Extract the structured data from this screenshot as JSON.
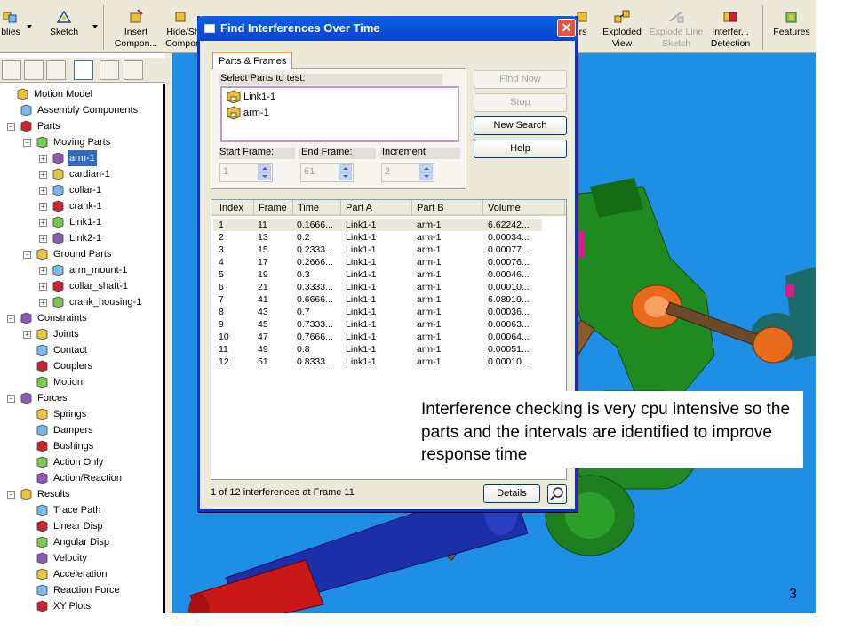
{
  "toolbar": {
    "items": [
      {
        "label": "blies",
        "icon": "assemblies-icon"
      },
      {
        "label": "Sketch",
        "icon": "sketch-icon"
      },
      {
        "label": "Insert Compon...",
        "icon": "insert-component-icon"
      },
      {
        "label": "Hide/Sh Compon",
        "icon": "hide-show-icon"
      },
      {
        "label": "rs",
        "icon": "partial-icon"
      },
      {
        "label": "Exploded View",
        "icon": "exploded-view-icon"
      },
      {
        "label": "Explode Line Sketch",
        "icon": "explode-line-sketch-icon",
        "disabled": true
      },
      {
        "label": "Interfer... Detection",
        "icon": "interference-detection-icon"
      },
      {
        "label": "Features",
        "icon": "features-icon"
      }
    ]
  },
  "tree": {
    "nodes": [
      {
        "label": "Motion Model",
        "level": 0,
        "icon": "motion-model-icon"
      },
      {
        "label": "Assembly Components",
        "level": 1,
        "icon": "assembly-components-icon"
      },
      {
        "label": "Parts",
        "level": 1,
        "icon": "parts-icon",
        "expander": "-"
      },
      {
        "label": "Moving Parts",
        "level": 2,
        "icon": "moving-parts-icon",
        "expander": "-"
      },
      {
        "label": "arm-1",
        "level": 3,
        "icon": "part-icon",
        "expander": "+",
        "selected": true
      },
      {
        "label": "cardian-1",
        "level": 3,
        "icon": "part-icon",
        "expander": "+"
      },
      {
        "label": "collar-1",
        "level": 3,
        "icon": "part-icon",
        "expander": "+"
      },
      {
        "label": "crank-1",
        "level": 3,
        "icon": "part-icon",
        "expander": "+"
      },
      {
        "label": "Link1-1",
        "level": 3,
        "icon": "part-icon",
        "expander": "+"
      },
      {
        "label": "Link2-1",
        "level": 3,
        "icon": "part-icon",
        "expander": "+"
      },
      {
        "label": "Ground Parts",
        "level": 2,
        "icon": "ground-parts-icon",
        "expander": "-"
      },
      {
        "label": "arm_mount-1",
        "level": 3,
        "icon": "ground-part-icon",
        "expander": "+"
      },
      {
        "label": "collar_shaft-1",
        "level": 3,
        "icon": "ground-part-icon",
        "expander": "+"
      },
      {
        "label": "crank_housing-1",
        "level": 3,
        "icon": "ground-part-icon",
        "expander": "+"
      },
      {
        "label": "Constraints",
        "level": 1,
        "icon": "constraints-icon",
        "expander": "-"
      },
      {
        "label": "Joints",
        "level": 2,
        "icon": "joints-icon",
        "expander": "+"
      },
      {
        "label": "Contact",
        "level": 2,
        "icon": "contact-icon"
      },
      {
        "label": "Couplers",
        "level": 2,
        "icon": "couplers-icon"
      },
      {
        "label": "Motion",
        "level": 2,
        "icon": "motion-icon"
      },
      {
        "label": "Forces",
        "level": 1,
        "icon": "forces-icon",
        "expander": "-"
      },
      {
        "label": "Springs",
        "level": 2,
        "icon": "springs-icon"
      },
      {
        "label": "Dampers",
        "level": 2,
        "icon": "dampers-icon"
      },
      {
        "label": "Bushings",
        "level": 2,
        "icon": "bushings-icon"
      },
      {
        "label": "Action Only",
        "level": 2,
        "icon": "action-only-icon"
      },
      {
        "label": "Action/Reaction",
        "level": 2,
        "icon": "action-reaction-icon"
      },
      {
        "label": "Results",
        "level": 1,
        "icon": "results-icon",
        "expander": "-"
      },
      {
        "label": "Trace Path",
        "level": 2,
        "icon": "trace-path-icon"
      },
      {
        "label": "Linear Disp",
        "level": 2,
        "icon": "linear-disp-icon"
      },
      {
        "label": "Angular Disp",
        "level": 2,
        "icon": "angular-disp-icon"
      },
      {
        "label": "Velocity",
        "level": 2,
        "icon": "velocity-icon"
      },
      {
        "label": "Acceleration",
        "level": 2,
        "icon": "acceleration-icon"
      },
      {
        "label": "Reaction Force",
        "level": 2,
        "icon": "reaction-force-icon"
      },
      {
        "label": "XY Plots",
        "level": 2,
        "icon": "xy-plots-icon"
      }
    ]
  },
  "dialog": {
    "title": "Find Interferences Over Time",
    "tab_label": "Parts & Frames",
    "select_parts_label": "Select Parts to test:",
    "parts": [
      "Link1-1",
      "arm-1"
    ],
    "start_frame_label": "Start Frame:",
    "end_frame_label": "End Frame:",
    "increment_label": "Increment",
    "start_frame_value": "1",
    "end_frame_value": "61",
    "increment_value": "2",
    "buttons": {
      "find_now": "Find Now",
      "stop": "Stop",
      "new_search": "New Search",
      "help": "Help",
      "details": "Details"
    },
    "columns": [
      "Index",
      "Frame",
      "Time",
      "Part A",
      "Part B",
      "Volume"
    ],
    "rows": [
      [
        "1",
        "11",
        "0.1666...",
        "Link1-1",
        "arm-1",
        "6.62242..."
      ],
      [
        "2",
        "13",
        "0.2",
        "Link1-1",
        "arm-1",
        "0.00034..."
      ],
      [
        "3",
        "15",
        "0.2333...",
        "Link1-1",
        "arm-1",
        "0.00077..."
      ],
      [
        "4",
        "17",
        "0.2666...",
        "Link1-1",
        "arm-1",
        "0.00076..."
      ],
      [
        "5",
        "19",
        "0.3",
        "Link1-1",
        "arm-1",
        "0.00046..."
      ],
      [
        "6",
        "21",
        "0.3333...",
        "Link1-1",
        "arm-1",
        "0.00010..."
      ],
      [
        "7",
        "41",
        "0.6666...",
        "Link1-1",
        "arm-1",
        "6.08919..."
      ],
      [
        "8",
        "43",
        "0.7",
        "Link1-1",
        "arm-1",
        "0.00036..."
      ],
      [
        "9",
        "45",
        "0.7333...",
        "Link1-1",
        "arm-1",
        "0.00063..."
      ],
      [
        "10",
        "47",
        "0.7666...",
        "Link1-1",
        "arm-1",
        "0.00064..."
      ],
      [
        "11",
        "49",
        "0.8",
        "Link1-1",
        "arm-1",
        "0.00051..."
      ],
      [
        "12",
        "51",
        "0.8333...",
        "Link1-1",
        "arm-1",
        "0.00010..."
      ]
    ],
    "status": "1 of 12 interferences at Frame 11"
  },
  "callout": {
    "text": "Interference checking is very cpu intensive so the parts and the intervals are identified to improve response time"
  },
  "slide_number": "3",
  "colors": {
    "viewport_bg": "#1f8fe6",
    "titlebar": "#0a5fe8",
    "selection": "#316ac5"
  }
}
